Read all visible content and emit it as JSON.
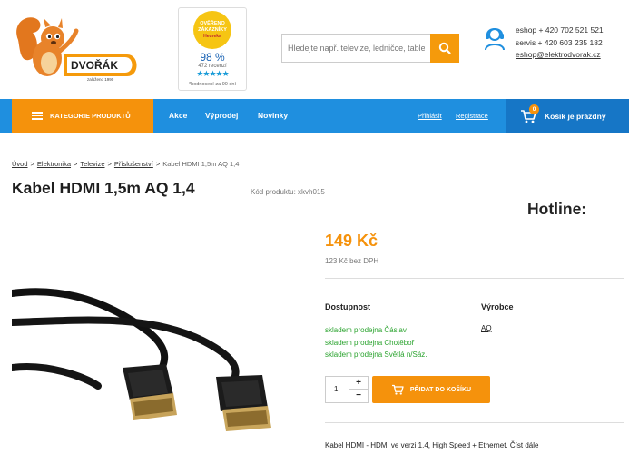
{
  "header": {
    "logo": {
      "brand": "DVOŘÁK",
      "since": "založeno 1990"
    },
    "badge": {
      "seal_text": "OVĚŘENO ZÁKAZNÍKY",
      "seal_brand": "Heureka",
      "percent": "98 %",
      "reviews": "472 recenzí",
      "stars": "★★★★★",
      "note": "*hodnocení za 90 dní"
    },
    "search": {
      "placeholder": "Hledejte např. televize, ledničce, tablet"
    },
    "hotline": {
      "title": "Hotline:",
      "eshop": "eshop + 420 702 521 521",
      "servis": "servis + 420 603 235 182",
      "email": "eshop@elektrodvorak.cz"
    }
  },
  "nav": {
    "categories": "KATEGORIE PRODUKTŮ",
    "links": [
      "Akce",
      "Výprodej",
      "Novinky"
    ],
    "login": "Přihlásit",
    "register": "Registrace",
    "cart_count": "0",
    "cart_label": "Košík je prázdný"
  },
  "breadcrumb": [
    "Úvod",
    "Elektronika",
    "Televize",
    "Příslušenství",
    "Kabel HDMI 1,5m AQ 1,4"
  ],
  "product": {
    "title": "Kabel HDMI 1,5m AQ 1,4",
    "code": "Kód produktu: xkvh015",
    "price": "149 Kč",
    "price_novat": "123 Kč bez DPH",
    "availability_heading": "Dostupnost",
    "stock": [
      "skladem prodejna Čáslav",
      "skladem prodejna Chotěboř",
      "skladem prodejna Světlá n/Sáz."
    ],
    "maker_heading": "Výrobce",
    "maker": "AQ",
    "quantity": "1",
    "add_to_cart": "PŘIDAT DO KOŠÍKU",
    "description": "Kabel HDMI - HDMI ve verzi 1.4, High Speed + Ethernet.",
    "read_more": "Číst dále"
  },
  "colors": {
    "accent": "#f5920c",
    "nav": "#1f8fdf",
    "stock": "#2aa32e"
  }
}
